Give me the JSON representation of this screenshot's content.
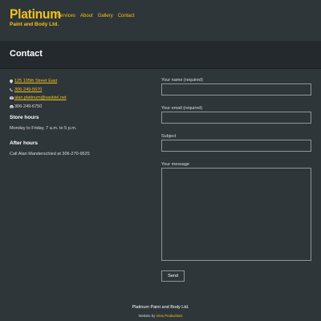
{
  "brand": {
    "title": "Platinum",
    "subtitle": "Paint and Body Ltd."
  },
  "nav": {
    "items": [
      "Services",
      "About",
      "Gallery",
      "Contact"
    ]
  },
  "banner": {
    "title": "Contact"
  },
  "contact": {
    "address": "125 105th Street East",
    "phone": "306-249-5670",
    "email": "alan.platinum@sasktel.net",
    "fax": "306-249-6750",
    "store_hours_heading": "Store hours",
    "store_hours_text": "Monday to Friday, 7 a.m. to 5 p.m.",
    "after_hours_heading": "After hours",
    "after_hours_text": "Call Alan Manderschied at 306-270-9525"
  },
  "form": {
    "name_label": "Your name (required)",
    "email_label": "Your email (required)",
    "subject_label": "Subject",
    "message_label": "Your message",
    "send_label": "Send"
  },
  "footer": {
    "name": "Platinum Paint and Body Ltd.",
    "credit_prefix": "Website by",
    "credit_link": "Vireo Productions"
  },
  "colors": {
    "accent": "#f2c21a",
    "background": "#2f363a",
    "banner": "#23292c"
  }
}
